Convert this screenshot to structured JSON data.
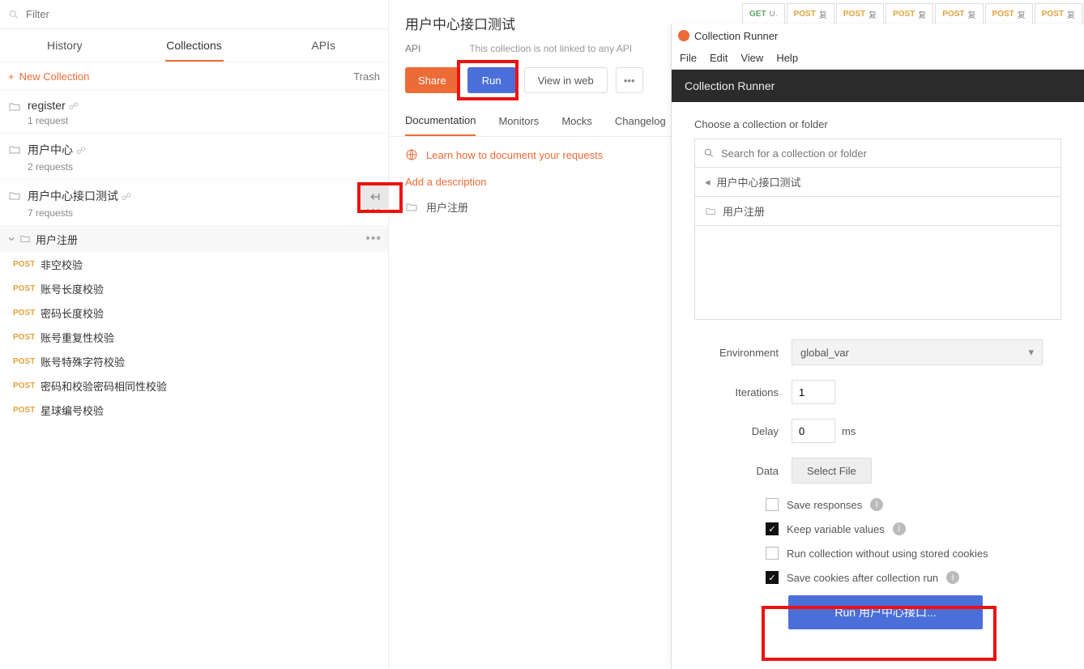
{
  "filter": {
    "placeholder": "Filter"
  },
  "tabs": {
    "history": "History",
    "collections": "Collections",
    "apis": "APIs"
  },
  "newCollection": "New Collection",
  "trash": "Trash",
  "collections": [
    {
      "name": "register",
      "sub": "1 request"
    },
    {
      "name": "用户中心",
      "sub": "2 requests"
    },
    {
      "name": "用户中心接口测试",
      "sub": "7 requests"
    }
  ],
  "folder": {
    "name": "用户注册"
  },
  "requests": [
    {
      "method": "POST",
      "name": "非空校验"
    },
    {
      "method": "POST",
      "name": "账号长度校验"
    },
    {
      "method": "POST",
      "name": "密码长度校验"
    },
    {
      "method": "POST",
      "name": "账号重复性校验"
    },
    {
      "method": "POST",
      "name": "账号特殊字符校验"
    },
    {
      "method": "POST",
      "name": "密码和校验密码相同性校验"
    },
    {
      "method": "POST",
      "name": "星球编号校验"
    }
  ],
  "mid": {
    "title": "用户中心接口测试",
    "apiLabel": "API",
    "apiText": "This collection is not linked to any API",
    "share": "Share",
    "run": "Run",
    "view": "View in web",
    "subtabs": {
      "doc": "Documentation",
      "mon": "Monitors",
      "mock": "Mocks",
      "change": "Changelog"
    },
    "learn": "Learn how to document your requests",
    "desc": "Add a description",
    "folder": "用户注册"
  },
  "runner": {
    "title": "Collection Runner",
    "menu": {
      "file": "File",
      "edit": "Edit",
      "view": "View",
      "help": "Help"
    },
    "header": "Collection Runner",
    "choose": "Choose a collection or folder",
    "searchPlaceholder": "Search for a collection or folder",
    "crumb": "用户中心接口测试",
    "item": "用户注册",
    "envLabel": "Environment",
    "envValue": "global_var",
    "iterLabel": "Iterations",
    "iterValue": "1",
    "delayLabel": "Delay",
    "delayValue": "0",
    "delayUnit": "ms",
    "dataLabel": "Data",
    "selectFile": "Select File",
    "cb1": "Save responses",
    "cb2": "Keep variable values",
    "cb3": "Run collection without using stored cookies",
    "cb4": "Save cookies after collection run",
    "runBtn": "Run 用户中心接口..."
  },
  "topTabs": [
    {
      "method": "GET",
      "label": "U."
    },
    {
      "method": "POST",
      "label": "复"
    },
    {
      "method": "POST",
      "label": "复"
    },
    {
      "method": "POST",
      "label": "复"
    },
    {
      "method": "POST",
      "label": "复"
    },
    {
      "method": "POST",
      "label": "复"
    },
    {
      "method": "POST",
      "label": "复"
    }
  ]
}
